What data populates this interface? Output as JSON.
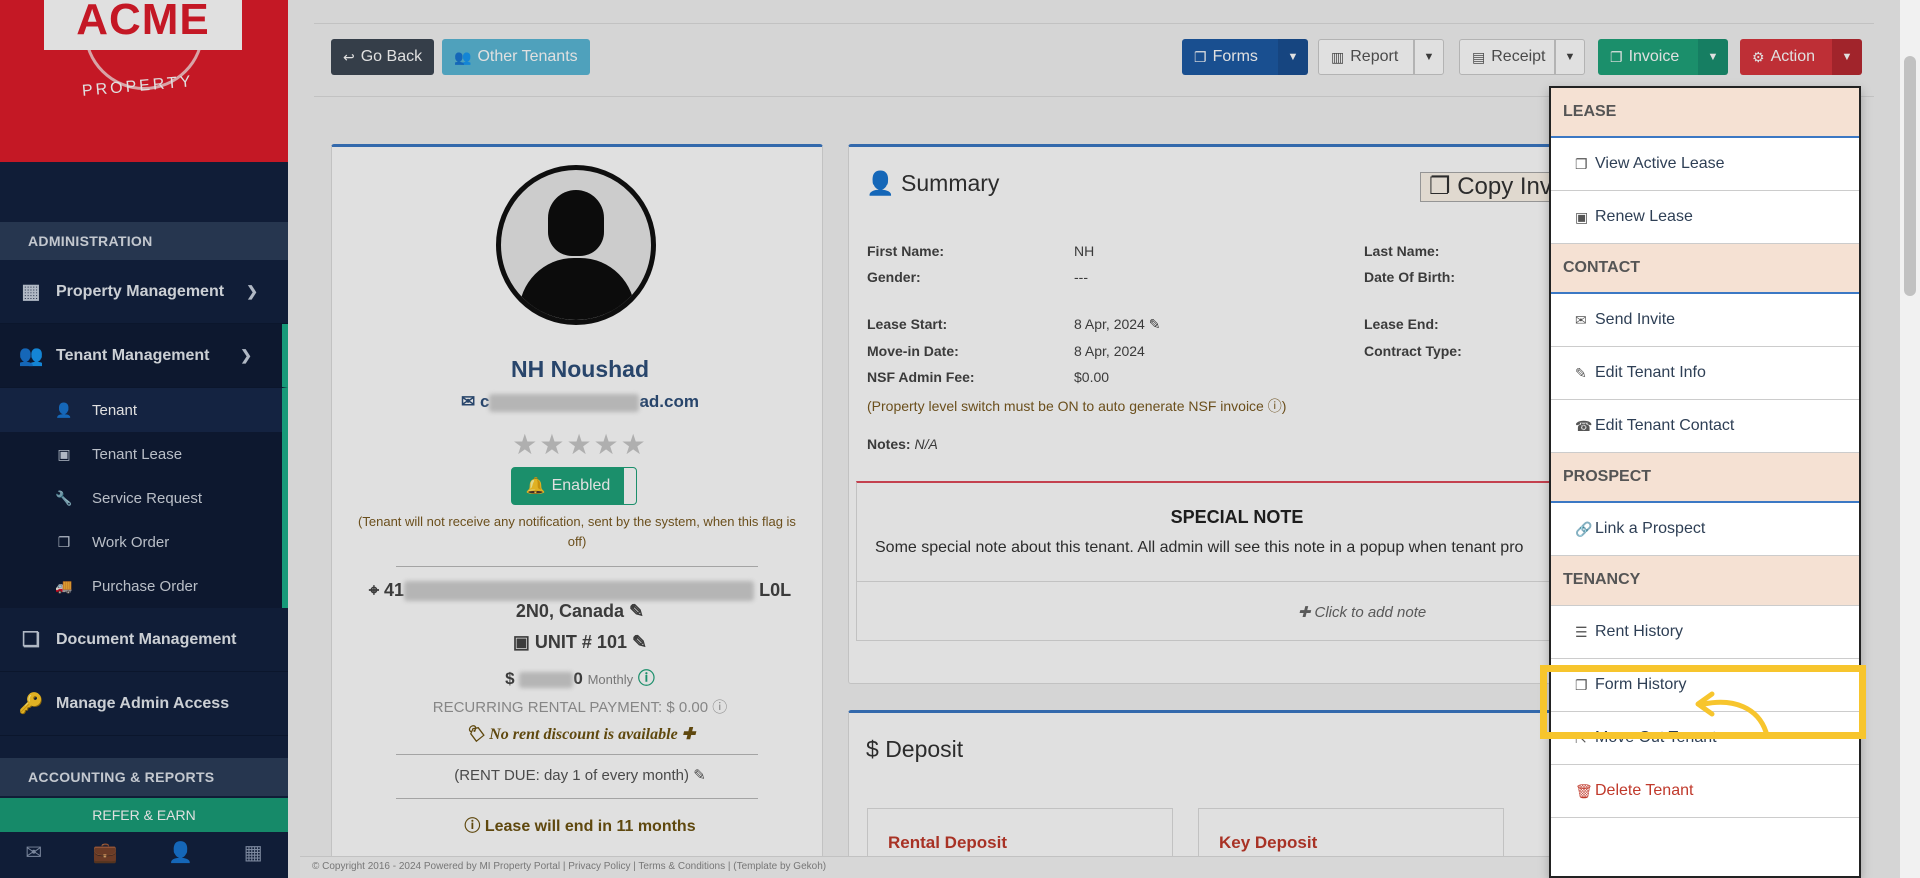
{
  "logo": {
    "name": "ACME",
    "sub": "PROPERTY"
  },
  "sidebar": {
    "admin_header": "ADMINISTRATION",
    "menus": [
      {
        "label": "Property Management",
        "icon": "building-icon"
      },
      {
        "label": "Tenant Management",
        "icon": "users-icon"
      }
    ],
    "tenant_sub": [
      "Tenant",
      "Tenant Lease",
      "Service Request",
      "Work Order",
      "Purchase Order"
    ],
    "menus2": [
      "Document Management",
      "Manage Admin Access"
    ],
    "acct_header": "ACCOUNTING & REPORTS",
    "refer": "REFER & EARN"
  },
  "toolbar": {
    "go_back": "Go Back",
    "other_tenants": "Other Tenants",
    "forms": "Forms",
    "report": "Report",
    "receipt": "Receipt",
    "invoice": "Invoice",
    "action": "Action"
  },
  "profile": {
    "name": "NH Noushad",
    "email_prefix": "c",
    "email_suffix": "ad.com",
    "stars": "★★★★★",
    "enabled": "Enabled",
    "notify_note": "(Tenant will not receive any notification, sent by the system, when this flag is off)",
    "addr_start": "41",
    "addr_end": "L0L",
    "addr_line2": "2N0, Canada",
    "unit": "UNIT # 101",
    "rent_prefix": "$",
    "rent_suffix": "0",
    "rent_period": "Monthly",
    "recurring": "RECURRING RENTAL PAYMENT: $ 0.00",
    "discount": "No rent discount is available",
    "rent_due": "(RENT DUE: day 1 of every month)",
    "lease_end": "Lease will end in 11 months"
  },
  "summary": {
    "title": "Summary",
    "copy": "Copy Inv",
    "first_name_label": "First Name:",
    "first_name": "NH",
    "gender_label": "Gender:",
    "gender": "---",
    "last_name_label": "Last Name:",
    "dob_label": "Date Of Birth:",
    "lease_start_label": "Lease Start:",
    "lease_start": "8 Apr, 2024",
    "movein_label": "Move-in Date:",
    "movein": "8 Apr, 2024",
    "nsf_label": "NSF Admin Fee:",
    "nsf": "$0.00",
    "lease_end_label": "Lease End:",
    "contract_label": "Contract Type:",
    "nsf_note": "(Property level switch must be ON to auto generate NSF invoice",
    "notes_label": "Notes:",
    "notes": "N/A"
  },
  "special": {
    "title": "SPECIAL NOTE",
    "body": "Some special note about this tenant. All admin will see this note in a popup when tenant pro",
    "add": "Click to add note"
  },
  "deposit": {
    "title": "Deposit",
    "box1": "Rental Deposit",
    "box2": "Key Deposit"
  },
  "footer": {
    "text": "© Copyright 2016 - 2024 Powered by MI Property Portal | Privacy Policy | Terms & Conditions | (Template by Gekoh)"
  },
  "dropdown": {
    "lease": "LEASE",
    "view_active_lease": "View Active Lease",
    "renew_lease": "Renew Lease",
    "contact": "CONTACT",
    "send_invite": "Send Invite",
    "edit_info": "Edit Tenant Info",
    "edit_contact": "Edit Tenant Contact",
    "prospect": "PROSPECT",
    "link_prospect": "Link a Prospect",
    "tenancy": "TENANCY",
    "rent_history": "Rent History",
    "form_history": "Form History",
    "move_out": "Move Out Tenant",
    "delete": "Delete Tenant"
  },
  "colors": {
    "accent_red": "#e01c2b",
    "sidebar": "#13223f",
    "invoice_green": "#1fa37a",
    "forms_blue": "#1d5aa4",
    "action_red": "#d9363e",
    "highlight": "#f7c52d"
  }
}
